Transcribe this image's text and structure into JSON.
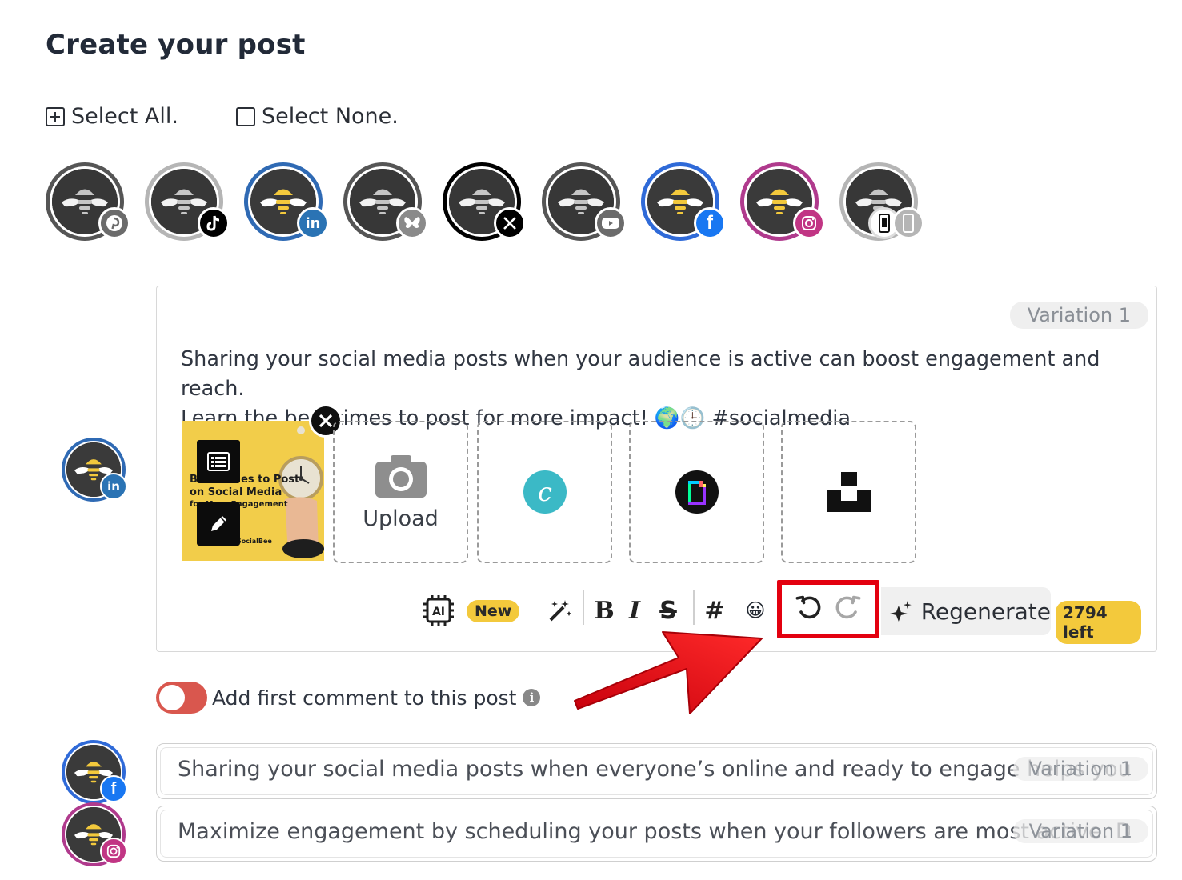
{
  "header": {
    "title": "Create your post"
  },
  "selection": {
    "select_all": "Select All.",
    "select_none": "Select None."
  },
  "profiles": [
    {
      "network": "pinterest",
      "icon": "pinterest-icon",
      "ring": "#555555",
      "badge": "#6b6b6b",
      "active": false
    },
    {
      "network": "tiktok",
      "icon": "tiktok-icon",
      "ring": "#b5b5b5",
      "badge": "#000000",
      "active": false
    },
    {
      "network": "linkedin",
      "icon": "linkedin-icon",
      "ring": "#2f6ab4",
      "badge": "#2a73b4",
      "active": true
    },
    {
      "network": "bluesky",
      "icon": "butterfly-icon",
      "ring": "#555555",
      "badge": "#8a8a8a",
      "active": false
    },
    {
      "network": "x",
      "icon": "x-icon",
      "ring": "#000000",
      "badge": "#000000",
      "active": false
    },
    {
      "network": "youtube",
      "icon": "youtube-icon",
      "ring": "#555555",
      "badge": "#6b6b6b",
      "active": false
    },
    {
      "network": "facebook",
      "icon": "facebook-icon",
      "ring": "#2f6ad8",
      "badge": "#1877f2",
      "active": true
    },
    {
      "network": "instagram",
      "icon": "instagram-icon",
      "ring": "#b03a8d",
      "badge": "#c13584",
      "active": true
    },
    {
      "network": "mobile",
      "icon": "phone-icon",
      "ring": "#b5b5b5",
      "badge": "#ffffff",
      "active": false
    }
  ],
  "editor": {
    "variation_label": "Variation 1",
    "post_text_line1": "Sharing your social media posts when your audience is active can boost engagement and reach.",
    "post_text_line2": "Learn the best times to post for more impact! 🌍🕒 #socialmedia",
    "thumbnail": {
      "title_line1": "Best Times to Post",
      "title_line2": "on Social Media",
      "title_line3": "for More Engagement",
      "brand": "SocialBee"
    },
    "upload_label": "Upload",
    "sources": [
      "canva-icon",
      "giphy-icon",
      "unsplash-icon"
    ],
    "toolbar": {
      "ai_label": "AI",
      "new_badge": "New",
      "bold": "B",
      "italic": "I",
      "strike": "S",
      "hashtag": "#",
      "emoji": "😀",
      "regenerate_label": "Regenerate",
      "chars_left": "2794 left"
    }
  },
  "first_comment": {
    "label": "Add first comment to this post",
    "enabled": true
  },
  "variants": [
    {
      "network": "facebook",
      "text": "Sharing your social media posts when everyone’s online and ready to engage helps your c...",
      "label": "Variation 1"
    },
    {
      "network": "instagram",
      "text": "Maximize engagement by scheduling your posts when your followers are most active. Dis...",
      "label": "Variation 1"
    }
  ],
  "colors": {
    "highlight": "#e3000f",
    "accent_yellow": "#f3c93c",
    "toggle_on": "#d9574e"
  }
}
